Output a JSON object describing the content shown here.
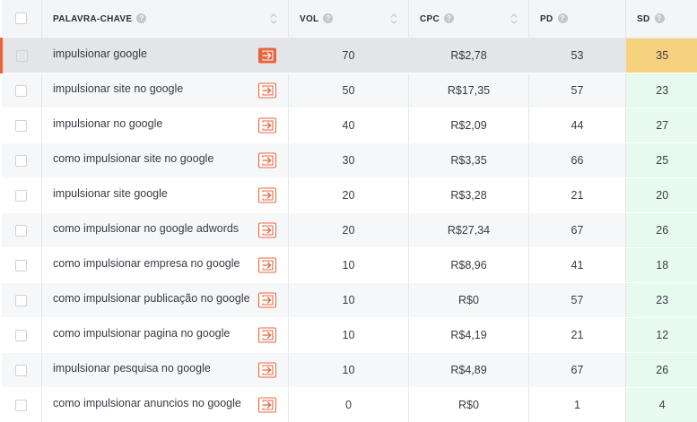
{
  "header": {
    "keyword": "PALAVRA-CHAVE",
    "vol": "VOL",
    "cpc": "CPC",
    "pd": "PD",
    "sd": "SD",
    "help_icon": "?"
  },
  "rows": [
    {
      "keyword": "impulsionar google",
      "vol": "70",
      "cpc": "R$2,78",
      "pd": "53",
      "sd": "35"
    },
    {
      "keyword": "impulsionar site no google",
      "vol": "50",
      "cpc": "R$17,35",
      "pd": "57",
      "sd": "23"
    },
    {
      "keyword": "impulsionar no google",
      "vol": "40",
      "cpc": "R$2,09",
      "pd": "44",
      "sd": "27"
    },
    {
      "keyword": "como impulsionar site no google",
      "vol": "30",
      "cpc": "R$3,35",
      "pd": "66",
      "sd": "25"
    },
    {
      "keyword": "impulsionar site google",
      "vol": "20",
      "cpc": "R$3,28",
      "pd": "21",
      "sd": "20"
    },
    {
      "keyword": "como impulsionar no google adwords",
      "vol": "20",
      "cpc": "R$27,34",
      "pd": "67",
      "sd": "26"
    },
    {
      "keyword": "como impulsionar empresa no google",
      "vol": "10",
      "cpc": "R$8,96",
      "pd": "41",
      "sd": "18"
    },
    {
      "keyword": "como impulsionar publicação no google",
      "vol": "10",
      "cpc": "R$0",
      "pd": "57",
      "sd": "23"
    },
    {
      "keyword": "como impulsionar pagina no google",
      "vol": "10",
      "cpc": "R$4,19",
      "pd": "21",
      "sd": "12"
    },
    {
      "keyword": "impulsionar pesquisa no google",
      "vol": "10",
      "cpc": "R$4,89",
      "pd": "67",
      "sd": "26"
    },
    {
      "keyword": "como impulsionar anuncios no google",
      "vol": "0",
      "cpc": "R$0",
      "pd": "1",
      "sd": "4"
    }
  ],
  "colors": {
    "accent": "#e8643c",
    "sd_high": "#f7d27e",
    "sd_low": "#e9fbf1"
  },
  "icons": {
    "row_action": "arrow-into-box-icon",
    "sort": "sort-arrows-icon",
    "help": "question-circle-icon"
  }
}
